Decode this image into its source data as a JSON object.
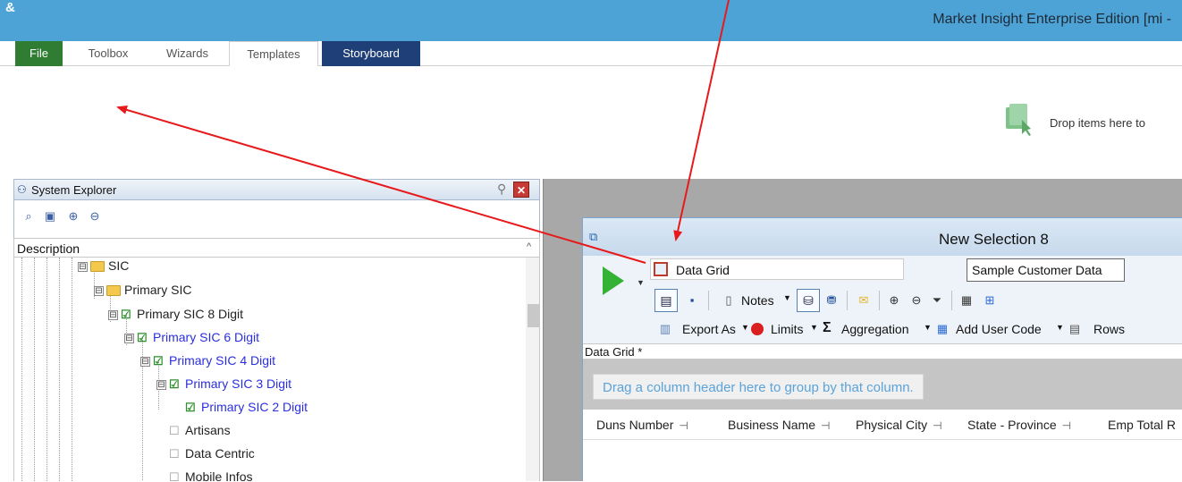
{
  "window": {
    "app_icon": "&",
    "title": "Market Insight Enterprise Edition [mi -"
  },
  "ribbon": {
    "tabs": [
      {
        "label": "File"
      },
      {
        "label": "Toolbox"
      },
      {
        "label": "Wizards"
      },
      {
        "label": "Templates"
      },
      {
        "label": "Storyboard"
      }
    ],
    "drop_hint": "Drop items here to"
  },
  "system_explorer": {
    "title": "System Explorer",
    "toolbar_icons": [
      "find-icon",
      "save-view-icon",
      "expand-all-icon",
      "collapse-all-icon"
    ],
    "column_header": "Description",
    "tree": [
      {
        "label": "SIC",
        "type": "folder",
        "expander": "⊟"
      },
      {
        "label": "Primary SIC",
        "type": "folder",
        "expander": "⊟"
      },
      {
        "label": "Primary SIC 8 Digit",
        "type": "checked",
        "expander": "⊟",
        "color": "#111111"
      },
      {
        "label": "Primary SIC 6 Digit",
        "type": "checked",
        "expander": "⊟",
        "color": "#2a2ee0"
      },
      {
        "label": "Primary SIC 4 Digit",
        "type": "checked",
        "expander": "⊟",
        "color": "#2a2ee0"
      },
      {
        "label": "Primary SIC 3 Digit",
        "type": "checked",
        "expander": "⊟",
        "color": "#2a2ee0"
      },
      {
        "label": "Primary SIC 2 Digit",
        "type": "checked",
        "expander": "",
        "color": "#2a2ee0"
      },
      {
        "label": "Artisans",
        "type": "unchecked"
      },
      {
        "label": "Data Centric",
        "type": "unchecked"
      },
      {
        "label": "Mobile Infos",
        "type": "unchecked"
      }
    ]
  },
  "selection_window": {
    "title": "New Selection 8",
    "grid_name": "Data Grid",
    "data_source": "Sample Customer Data",
    "toolbar": {
      "notes": "Notes",
      "export_as": "Export As",
      "limits": "Limits",
      "aggregation": "Aggregation",
      "add_user_code": "Add User Code",
      "rows": "Rows"
    },
    "grid_label": "Data Grid *",
    "group_hint": "Drag a column header here to group by that column.",
    "columns": [
      "Duns Number",
      "Business Name",
      "Physical City",
      "State - Province",
      "Emp Total R"
    ]
  },
  "annotation_color": "#e8191b"
}
